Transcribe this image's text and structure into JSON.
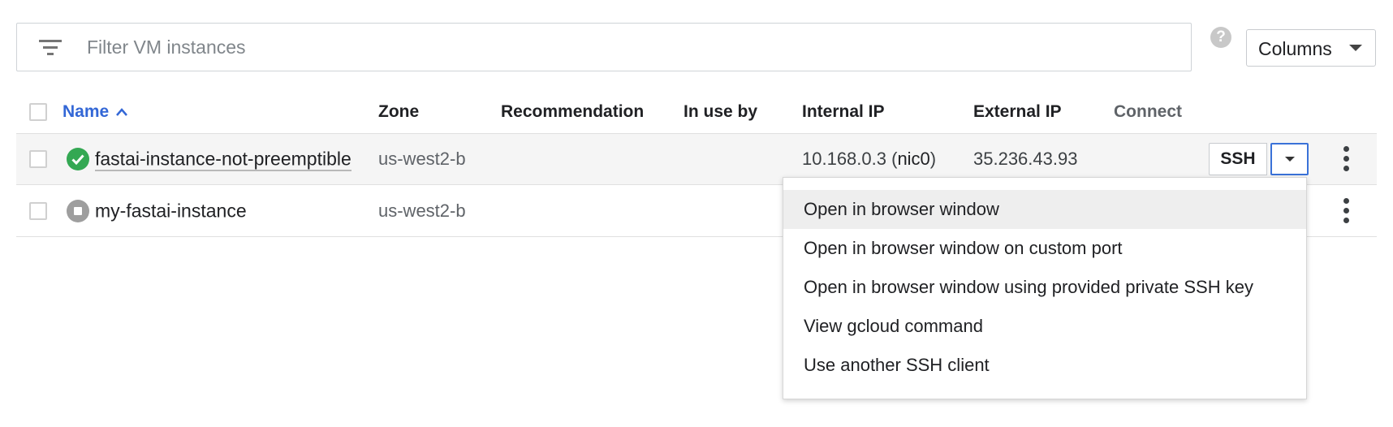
{
  "filter": {
    "placeholder": "Filter VM instances",
    "filter_icon": "filter-list-icon"
  },
  "help_icon": {
    "glyph": "?",
    "icon": "help-icon"
  },
  "columns_button": {
    "label": "Columns",
    "caret_icon": "caret-down-icon"
  },
  "table": {
    "headers": {
      "name": "Name",
      "zone": "Zone",
      "recommendation": "Recommendation",
      "in_use_by": "In use by",
      "internal_ip": "Internal IP",
      "external_ip": "External IP",
      "connect": "Connect"
    },
    "sort": {
      "column": "Name",
      "direction": "ascending",
      "icon": "sort-up-icon"
    },
    "rows": [
      {
        "name": "fastai-instance-not-preemptible",
        "status": "running",
        "status_icon": "check-circle-icon",
        "zone": "us-west2-b",
        "recommendation": "",
        "in_use_by": "",
        "internal_ip": "10.168.0.3",
        "internal_ip_open": "(",
        "nic": "nic0",
        "internal_ip_close": ")",
        "external_ip": "35.236.43.93",
        "connect_label": "SSH",
        "more_icon": "more-vert-icon"
      },
      {
        "name": "my-fastai-instance",
        "status": "stopped",
        "status_icon": "stopped-circle-icon",
        "zone": "us-west2-b",
        "recommendation": "",
        "in_use_by": "",
        "internal_ip": "",
        "external_ip": "",
        "more_icon": "more-vert-icon"
      }
    ]
  },
  "ssh_menu": {
    "items": [
      "Open in browser window",
      "Open in browser window on custom port",
      "Open in browser window using provided private SSH key",
      "View gcloud command",
      "Use another SSH client"
    ],
    "highlighted_index": 0
  },
  "colors": {
    "accent_blue": "#3367d6",
    "running_green": "#34a853",
    "stopped_gray": "#9e9e9e",
    "row_highlight": "#f5f5f5",
    "menu_highlight": "#eeeeee"
  }
}
